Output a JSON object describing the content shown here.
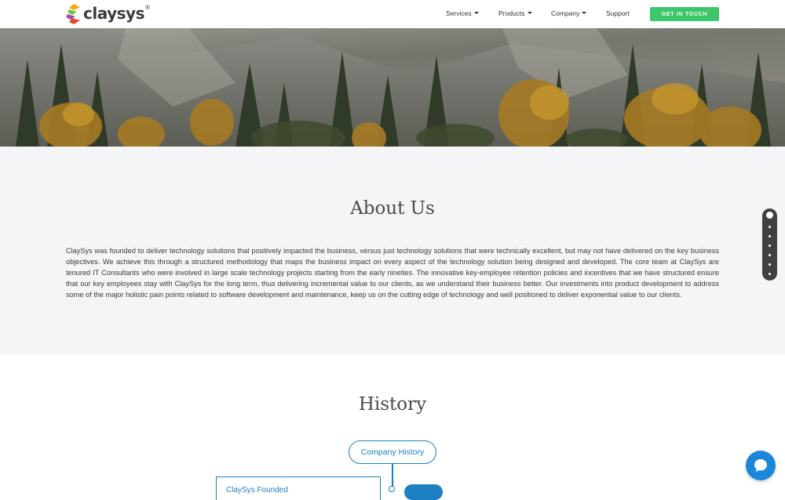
{
  "header": {
    "logo_text": "claysys",
    "logo_reg": "®",
    "nav": [
      {
        "label": "Services",
        "dropdown": true
      },
      {
        "label": "Products",
        "dropdown": true
      },
      {
        "label": "Company",
        "dropdown": true
      },
      {
        "label": "Support",
        "dropdown": false
      }
    ],
    "cta_label": "GET IN TOUCH"
  },
  "about": {
    "title": "About Us",
    "body": "ClaySys was founded to deliver technology solutions that positively impacted the business, versus just technology solutions that were technically excellent, but may not have delivered on the key business objectives. We achieve this through a structured methodology that maps the business impact on every aspect of the technology solution being designed and developed. The core team at ClaySys are tenured IT Consultants who were involved in large scale technology projects starting from the early nineties. The innovative key-employee retention policies and incentives that we have structured ensure that our key employees stay with ClaySys for the long term, thus delivering incremental value to our clients, as we understand their business better. Our investments into product development to address some of the major holistic pain points related to software development and maintenance, keep us on the cutting edge of technology and well positioned to deliver exponential value to our clients."
  },
  "page_dots": {
    "count": 7,
    "active_index": 0
  },
  "history": {
    "title": "History",
    "root_label": "Company History",
    "first_card_label": "ClaySys Founded"
  },
  "colors": {
    "accent_green": "#3dc66a",
    "timeline_blue": "#1c7fc1",
    "chat_blue": "#1a87d8",
    "about_bg": "#f4f5f6"
  },
  "icons": {
    "chat": "chat-bubble-icon",
    "dropdown": "caret-down-icon"
  }
}
